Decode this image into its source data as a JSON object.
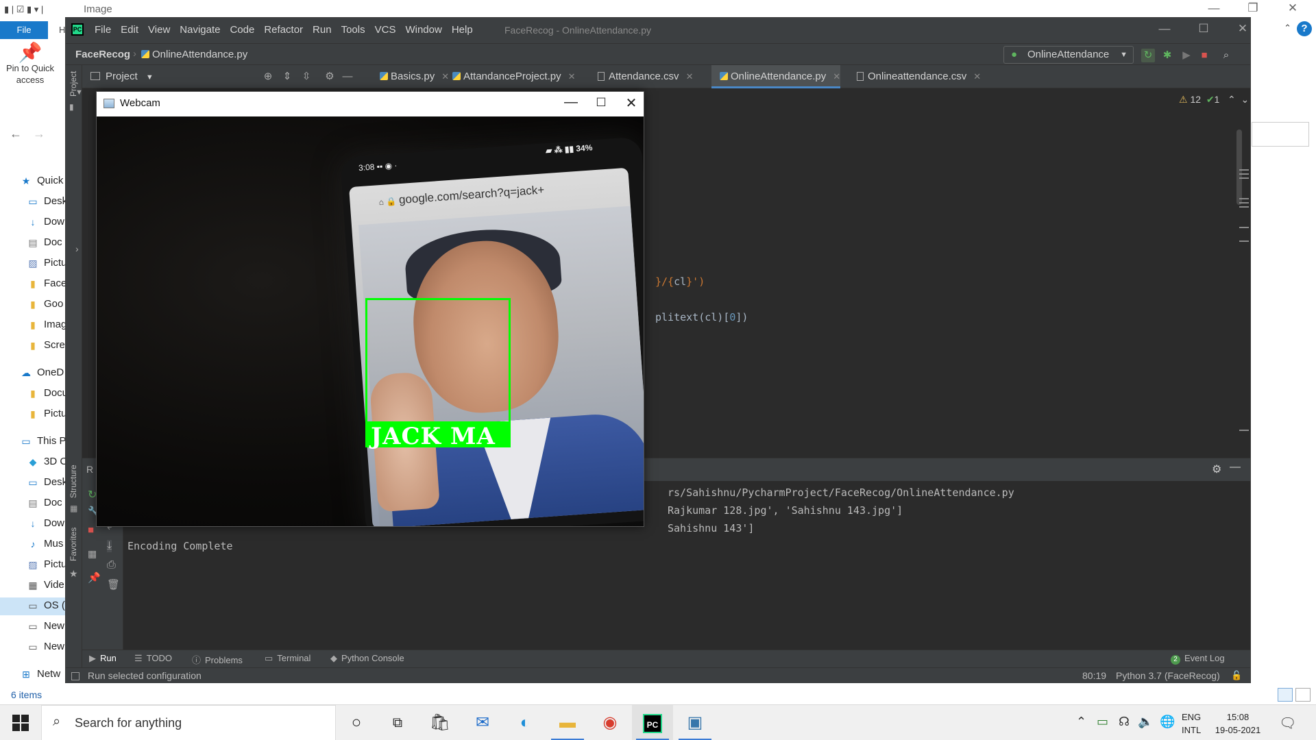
{
  "explorer": {
    "title": "Image",
    "file_tab": "File",
    "home_initial": "H",
    "pin_label_1": "Pin to Quick",
    "pin_label_2": "access",
    "nav": [
      {
        "label": "Quick",
        "icon": "star-icon",
        "top": true
      },
      {
        "label": "Desk",
        "icon": "desktop-icon"
      },
      {
        "label": "Dow",
        "icon": "download-icon"
      },
      {
        "label": "Doc",
        "icon": "document-icon"
      },
      {
        "label": "Pictu",
        "icon": "pictures-icon"
      },
      {
        "label": "Face",
        "icon": "folder-icon"
      },
      {
        "label": "Goo",
        "icon": "folder-icon"
      },
      {
        "label": "Imag",
        "icon": "folder-icon"
      },
      {
        "label": "Scre",
        "icon": "folder-icon"
      },
      {
        "label": "OneD",
        "icon": "cloud-icon",
        "top": true
      },
      {
        "label": "Docu",
        "icon": "folder-icon"
      },
      {
        "label": "Pictu",
        "icon": "folder-icon"
      },
      {
        "label": "This P",
        "icon": "computer-icon",
        "top": true
      },
      {
        "label": "3D C",
        "icon": "cube-icon"
      },
      {
        "label": "Desk",
        "icon": "desktop-icon"
      },
      {
        "label": "Doc",
        "icon": "document-icon"
      },
      {
        "label": "Dow",
        "icon": "download-icon"
      },
      {
        "label": "Mus",
        "icon": "music-icon"
      },
      {
        "label": "Pictu",
        "icon": "pictures-icon"
      },
      {
        "label": "Vide",
        "icon": "video-icon"
      },
      {
        "label": "OS (",
        "icon": "drive-icon",
        "selected": true
      },
      {
        "label": "New",
        "icon": "network-drive-icon"
      },
      {
        "label": "New",
        "icon": "network-drive-icon"
      },
      {
        "label": "Netw",
        "icon": "network-icon",
        "top": true
      }
    ],
    "status": "6 items"
  },
  "pycharm": {
    "menu": [
      "File",
      "Edit",
      "View",
      "Navigate",
      "Code",
      "Refactor",
      "Run",
      "Tools",
      "VCS",
      "Window",
      "Help"
    ],
    "window_title": "FaceRecog - OnlineAttendance.py",
    "breadcrumb_project": "FaceRecog",
    "breadcrumb_file": "OnlineAttendance.py",
    "run_config": "OnlineAttendance",
    "project_label": "Project",
    "tabs": [
      {
        "label": "Basics.py",
        "type": "py"
      },
      {
        "label": "AttandanceProject.py",
        "type": "py"
      },
      {
        "label": "Attendance.csv",
        "type": "csv"
      },
      {
        "label": "OnlineAttendance.py",
        "type": "py",
        "active": true
      },
      {
        "label": "Onlineattendance.csv",
        "type": "csv"
      }
    ],
    "inspections": {
      "warnings": "12",
      "ok": "1"
    },
    "code_lines": [
      {
        "segments": [
          {
            "t": "}/{",
            "c": "brace"
          },
          {
            "t": "cl",
            "c": "plain"
          },
          {
            "t": "}')",
            "c": "brace"
          }
        ]
      },
      {
        "segments": [
          {
            "t": "plitext(cl)[",
            "c": "plain"
          },
          {
            "t": "0",
            "c": "num"
          },
          {
            "t": "])",
            "c": "plain"
          }
        ]
      }
    ],
    "run_header": "R",
    "console_lines": [
      "rs/Sahishnu/PycharmProject/FaceRecog/OnlineAttendance.py",
      "Rajkumar 128.jpg', 'Sahishnu 143.jpg']",
      "Sahishnu 143']",
      "Encoding Complete"
    ],
    "left_tools": [
      "Project",
      "Structure",
      "Favorites"
    ],
    "bottom_tabs": [
      {
        "label": "Run",
        "icon": "play-icon",
        "active": true
      },
      {
        "label": "TODO",
        "icon": "list-icon"
      },
      {
        "label": "Problems",
        "icon": "info-icon"
      },
      {
        "label": "Terminal",
        "icon": "terminal-icon"
      },
      {
        "label": "Python Console",
        "icon": "python-icon"
      }
    ],
    "event_log": {
      "count": "2",
      "label": "Event Log"
    },
    "status_message": "Run selected configuration",
    "cursor_pos": "80:19",
    "interpreter": "Python 3.7 (FaceRecog)"
  },
  "webcam": {
    "title": "Webcam",
    "detected_name": "JACK MA",
    "phone_time": "3:08",
    "phone_battery": "34%",
    "phone_url": "google.com/search?q=jack+"
  },
  "taskbar": {
    "search_placeholder": "Search for anything",
    "lang_1": "ENG",
    "lang_2": "INTL",
    "time": "15:08",
    "date": "19-05-2021"
  }
}
